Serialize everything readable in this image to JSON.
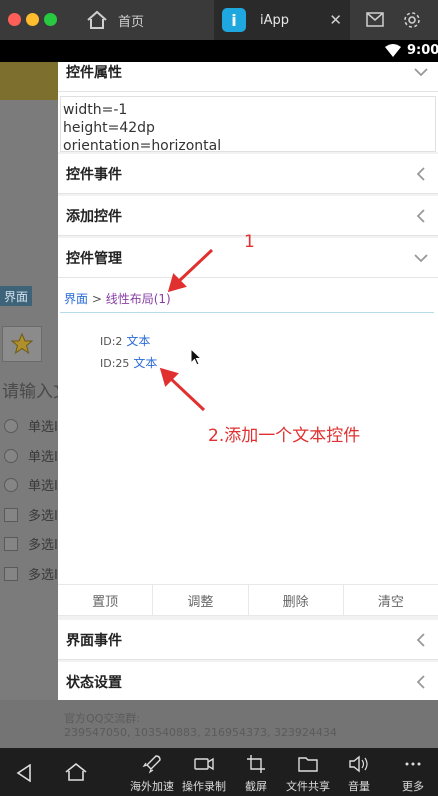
{
  "window": {
    "tabs": [
      {
        "label": "首页",
        "icon": "home-icon"
      },
      {
        "label": "iApp",
        "icon": "iapp-icon",
        "app_letter": "i",
        "close": "✕"
      }
    ]
  },
  "status_bar": {
    "time": "9:00"
  },
  "background_app": {
    "tag": "界面",
    "input_placeholder": "请输入文",
    "options": [
      "单选I",
      "单选I",
      "单选I",
      "多选I",
      "多选I",
      "多选I"
    ],
    "footer_qq_title": "官方QQ交流群:",
    "footer_qq_groups": "239547050, 103540883, 216954373, 323924434"
  },
  "panel": {
    "sections": {
      "properties": "控件属性",
      "events": "控件事件",
      "add_control": "添加控件",
      "manage": "控件管理",
      "ui_events": "界面事件",
      "state_settings": "状态设置"
    },
    "properties_text": "width=-1\nheight=42dp\norientation=horizontal",
    "breadcrumb": {
      "root": "界面",
      "separator": ">",
      "current": "线性布局(1)"
    },
    "tree_items": [
      {
        "id": "ID:2",
        "label": "文本"
      },
      {
        "id": "ID:25",
        "label": "文本"
      }
    ],
    "actions": [
      "置顶",
      "调整",
      "删除",
      "清空"
    ]
  },
  "annotations": {
    "step1": "1",
    "step2": "2.添加一个文本控件",
    "color": "#e0302f"
  },
  "navbar": {
    "items": [
      "海外加速",
      "操作录制",
      "截屏",
      "文件共享",
      "音量",
      "更多"
    ]
  }
}
